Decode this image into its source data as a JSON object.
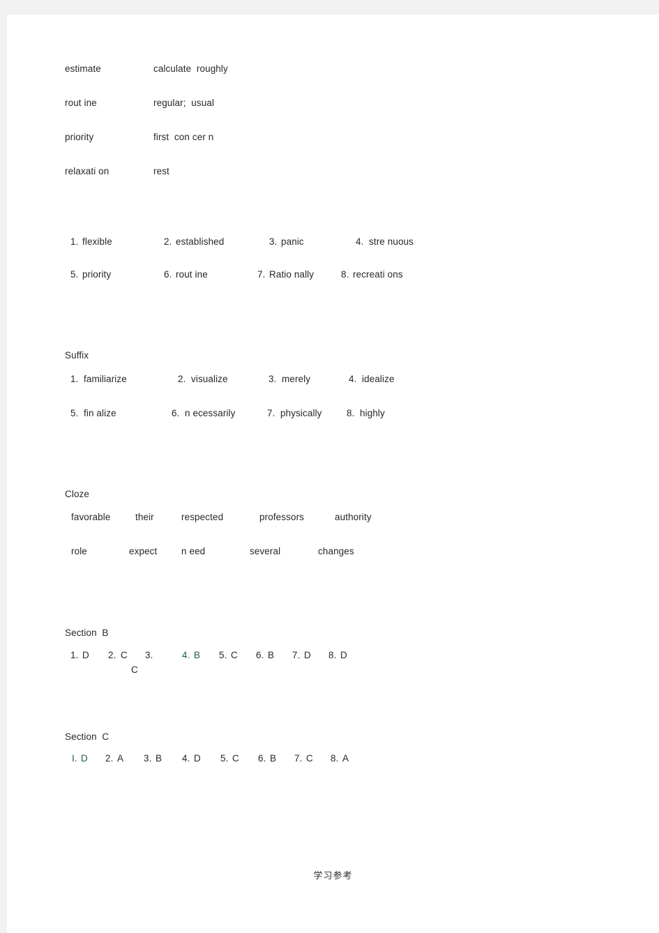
{
  "page": {
    "background_color": "#f2f2f2",
    "sheet_color": "#ffffff",
    "text_color": "#26282b",
    "accent_color": "#1d5b52"
  },
  "vocabulary": {
    "rows": [
      {
        "term": "estimate",
        "definition": "calculate  roughly"
      },
      {
        "term": "rout ine",
        "definition": "regular;  usual"
      },
      {
        "term": "priority",
        "definition": "first  con cer n"
      },
      {
        "term": "relaxati on",
        "definition": "rest"
      }
    ]
  },
  "word_answers": {
    "row1": [
      {
        "num": "1.",
        "word": "flexible"
      },
      {
        "num": "2.",
        "word": "established"
      },
      {
        "num": "3.",
        "word": "panic"
      },
      {
        "num": "4.",
        "word": "stre nuous"
      }
    ],
    "row2": [
      {
        "num": "5.",
        "word": "priority"
      },
      {
        "num": "6.",
        "word": "rout ine"
      },
      {
        "num": "7.",
        "word": "Ratio nally"
      },
      {
        "num": "8.",
        "word": "recreati ons"
      }
    ]
  },
  "suffix": {
    "heading": "Suffix",
    "row1": [
      {
        "num": "1.",
        "word": "familiarize"
      },
      {
        "num": "2.",
        "word": "visualize"
      },
      {
        "num": "3.",
        "word": "merely"
      },
      {
        "num": "4.",
        "word": "idealize"
      }
    ],
    "row2": [
      {
        "num": "5.",
        "word": "fin alize"
      },
      {
        "num": "6.",
        "word": "n ecessarily"
      },
      {
        "num": "7.",
        "word": "physically"
      },
      {
        "num": "8.",
        "word": "highly"
      }
    ]
  },
  "cloze": {
    "heading": "Cloze",
    "row1": [
      "favorable",
      "their",
      "respected",
      "professors",
      "authority"
    ],
    "row2": [
      "role",
      "expect",
      "n eed",
      "several",
      "changes"
    ]
  },
  "section_b": {
    "heading": "Section  B",
    "answers": [
      {
        "num": "1.",
        "letter": "D"
      },
      {
        "num": "2.",
        "letter": "C"
      },
      {
        "num": "3.",
        "letter": ""
      },
      {
        "num": "4.",
        "letter": "B"
      },
      {
        "num": "5.",
        "letter": "C"
      },
      {
        "num": "6.",
        "letter": "B"
      },
      {
        "num": "7.",
        "letter": "D"
      },
      {
        "num": "8.",
        "letter": "D"
      }
    ],
    "orphan_letter": "C"
  },
  "section_c": {
    "heading": "Section  C",
    "answers": [
      {
        "num": "I.",
        "letter": "D"
      },
      {
        "num": "2.",
        "letter": "A"
      },
      {
        "num": "3.",
        "letter": "B"
      },
      {
        "num": "4.",
        "letter": "D"
      },
      {
        "num": "5.",
        "letter": "C"
      },
      {
        "num": "6.",
        "letter": "B"
      },
      {
        "num": "7.",
        "letter": "C"
      },
      {
        "num": "8.",
        "letter": "A"
      }
    ]
  },
  "footer": {
    "mark": "学习参考"
  }
}
